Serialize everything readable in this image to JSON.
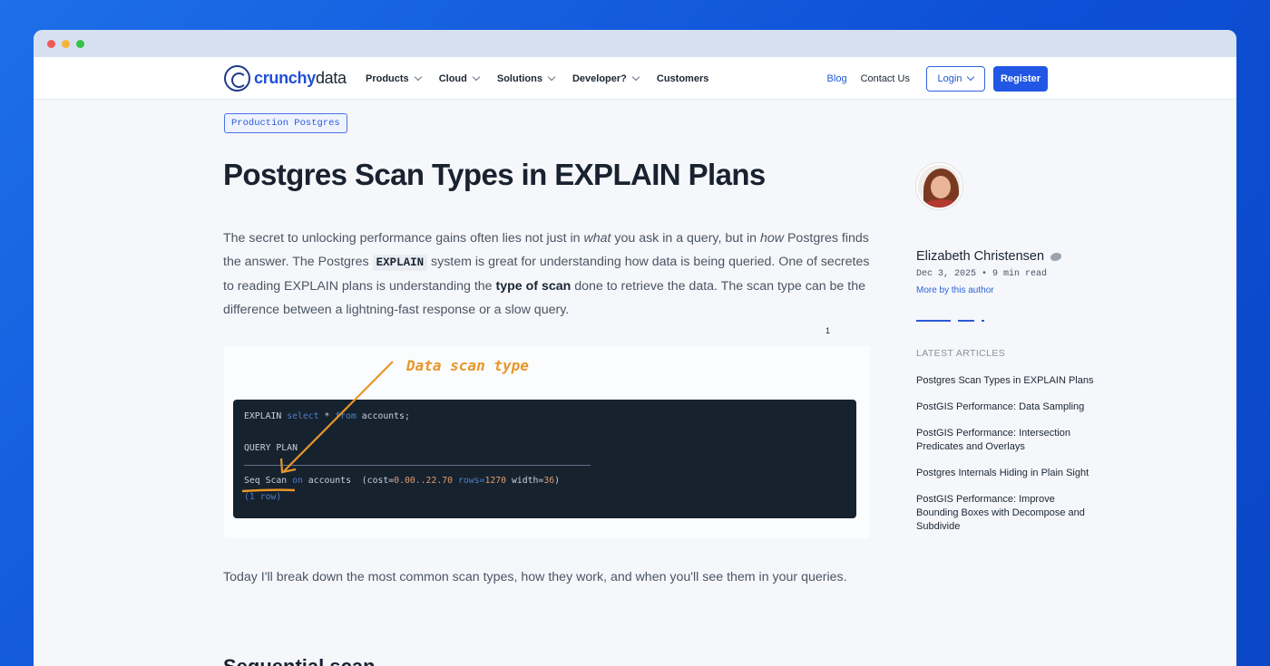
{
  "nav": {
    "logo_part1": "crunchy",
    "logo_part2": "data",
    "menu": [
      {
        "label": "Products",
        "has_dropdown": true
      },
      {
        "label": "Cloud",
        "has_dropdown": true
      },
      {
        "label": "Solutions",
        "has_dropdown": true
      },
      {
        "label": "Developer?",
        "has_dropdown": true
      },
      {
        "label": "Customers",
        "has_dropdown": false
      }
    ],
    "blog": "Blog",
    "contact": "Contact Us",
    "login": "Login",
    "register": "Register"
  },
  "article": {
    "tag": "Production Postgres",
    "title": "Postgres Scan Types in EXPLAIN Plans",
    "intro": {
      "p1": "The secret to unlocking performance gains often lies not just in ",
      "em1": "what",
      "p2": " you ask in a query, but in ",
      "em2": "how",
      "p3": " Postgres finds the answer. The Postgres ",
      "code": "EXPLAIN",
      "p4": " system is great for understanding how data is being queried. One of secretes to reading EXPLAIN plans is understanding the ",
      "strong": "type of scan",
      "p5": " done to retrieve the data. The scan type can be the difference between a lightning-fast response or a slow query."
    },
    "footnote": "1",
    "figure": {
      "annotation": "Data scan type",
      "line1_a": "EXPLAIN ",
      "line1_kw1": "select",
      "line1_b": " * ",
      "line1_kw2": "from",
      "line1_c": " accounts;",
      "line2": "QUERY PLAN",
      "line3_a": "Seq Scan ",
      "line3_kw": "on",
      "line3_b": " accounts  (cost=",
      "line3_num1": "0.00..22.70",
      "line3_kw2": " rows=",
      "line3_num2": "1270",
      "line3_c": " width=",
      "line3_num3": "36",
      "line3_d": ")",
      "line4": "(1 row)"
    },
    "after": "Today I'll break down the most common scan types, how they work, and when you'll see them in your queries.",
    "section_heading": "Sequential scan"
  },
  "sidebar": {
    "author": "Elizabeth Christensen",
    "meta": "Dec 3, 2025 • 9 min read",
    "more": "More by this author",
    "latest_label": "LATEST ARTICLES",
    "latest": [
      "Postgres Scan Types in EXPLAIN Plans",
      "PostGIS Performance: Data Sampling",
      "PostGIS Performance: Intersection Predicates and Overlays",
      "Postgres Internals Hiding in Plain Sight",
      "PostGIS Performance: Improve Bounding Boxes with Decompose and Subdivide"
    ]
  },
  "colors": {
    "brand_blue": "#2157e4",
    "background_gradient": "#1e6fe8",
    "annotation_orange": "#e8962a",
    "terminal_bg": "#17222f"
  }
}
